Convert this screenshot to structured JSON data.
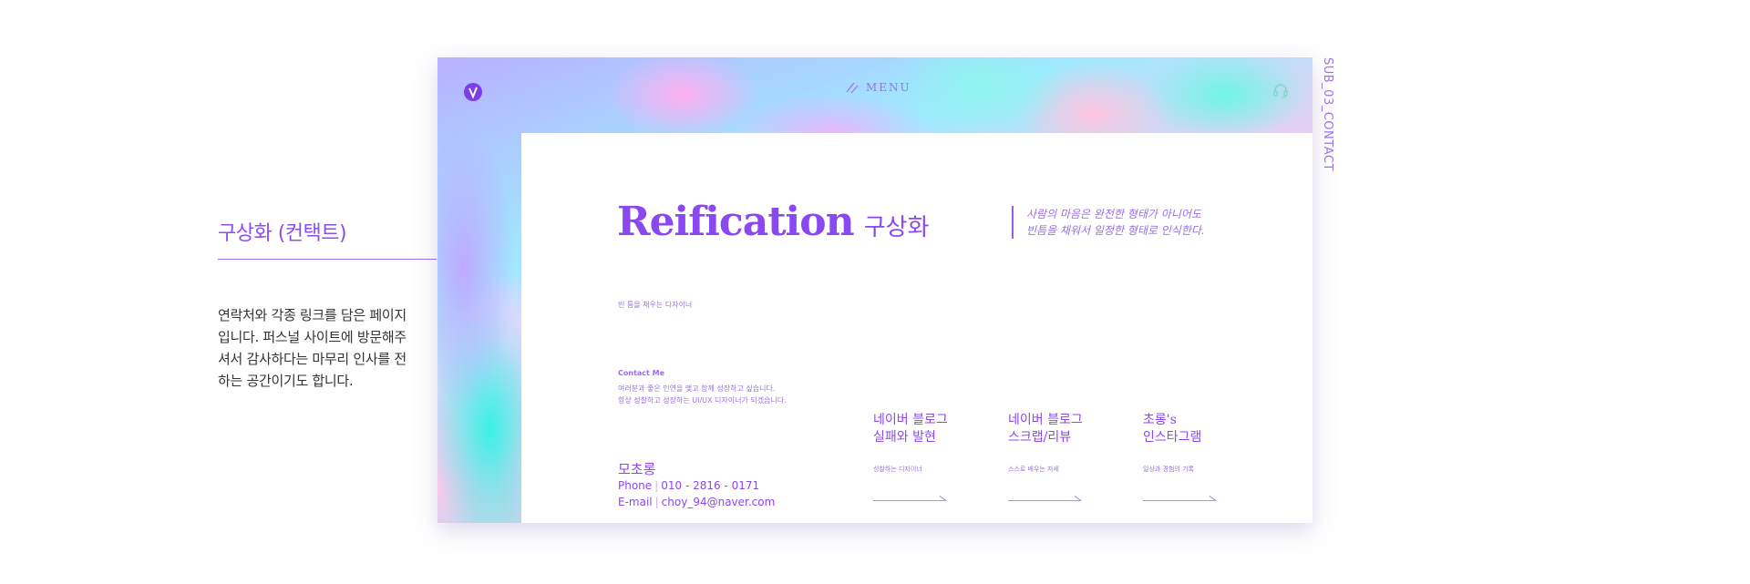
{
  "side_label": "SUB_03_CONTACT",
  "description": {
    "title": "구상화 (컨택트)",
    "body": "연락처와 각종 링크를 담은 페이지 입니다. 퍼스널 사이트에 방문해주셔서 감사하다는 마무리 인사를 전하는 공간이기도 합니다."
  },
  "header": {
    "menu_label": "MENU",
    "logo_icon": "v-logo-icon",
    "menu_icon": "slash-menu-icon",
    "support_icon": "headset-icon"
  },
  "hero": {
    "title_en": "Reification",
    "title_ko": "구상화",
    "subtitle": "빈 틈을 채우는 디자이너",
    "quote_line1": "사람의 마음은 완전한 형태가 아니어도",
    "quote_line2": "빈틈을 채워서 일정한 형태로 인식한다."
  },
  "contact": {
    "label": "Contact Me",
    "desc_line1": "여러분과 좋은 인연을 맺고 함께 성장하고 싶습니다.",
    "desc_line2": "항상 성찰하고 성장하는 UI/UX 디자이너가 되겠습니다.",
    "name": "모초롱",
    "phone_label": "Phone",
    "phone_value": "010 - 2816 - 0171",
    "email_label": "E-mail",
    "email_value": "choy_94@naver.com"
  },
  "links": [
    {
      "line1": "네이버 블로그",
      "line2": "실패와 발현",
      "sub": "성찰하는 디자이너"
    },
    {
      "line1": "네이버 블로그",
      "line2": "스크랩/리뷰",
      "sub": "스스로 배우는 자세"
    },
    {
      "line1": "초롱's",
      "line2": "인스타그램",
      "sub": "일상과 경험의 기록"
    }
  ],
  "colors": {
    "accent": "#8a48f0",
    "soft_accent": "#9a70e4"
  }
}
